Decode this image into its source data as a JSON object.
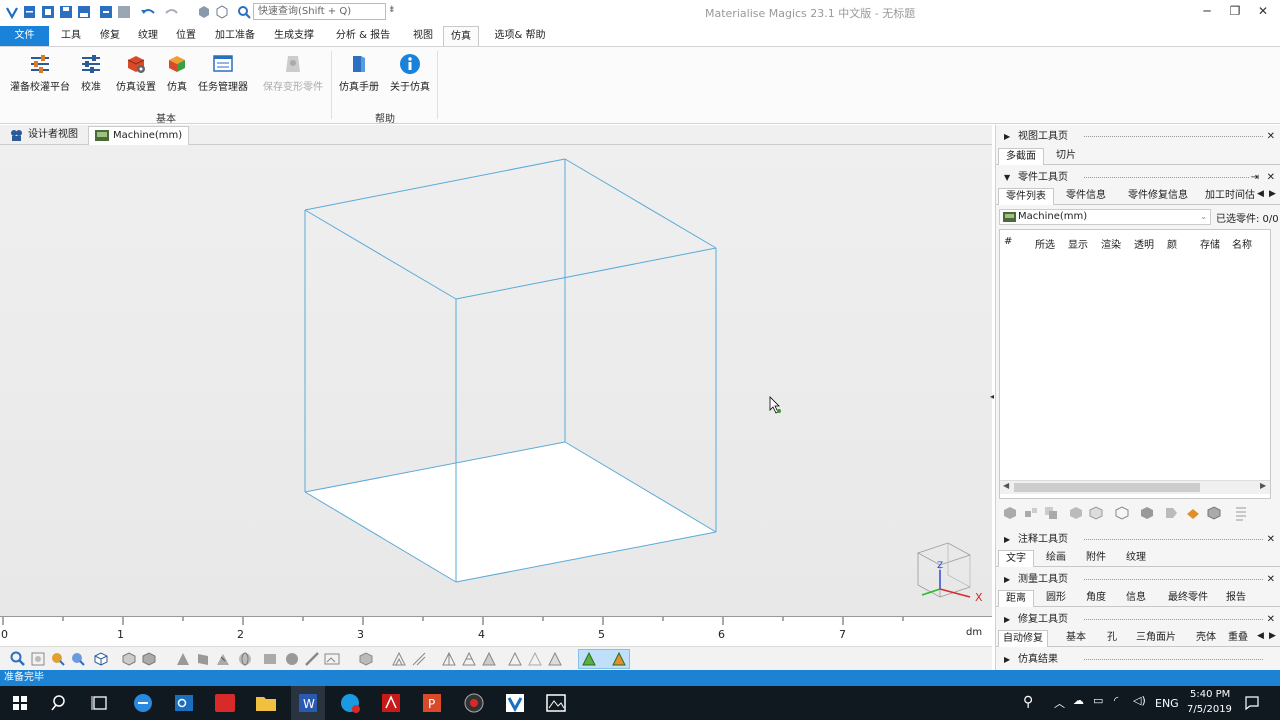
{
  "app": {
    "title": "Materialise Magics 23.1 中文版 - 无标题",
    "quick_search_placeholder": "快速查询(Shift + Q)"
  },
  "ribbon": {
    "tabs": [
      "文件",
      "工具",
      "修复",
      "纹理",
      "位置",
      "加工准备",
      "生成支撑",
      "分析 & 报告",
      "视图",
      "仿真",
      "选项& 帮助"
    ],
    "active_tab": "仿真",
    "groups": [
      {
        "label": "基本",
        "buttons": [
          "灌备校灌平台",
          "校准",
          "仿真设置",
          "仿真",
          "任务管理器",
          "保存变形零件"
        ]
      },
      {
        "label": "帮助",
        "buttons": [
          "仿真手册",
          "关于仿真"
        ]
      }
    ]
  },
  "doc_tabs": [
    "设计者视图",
    "Machine(mm)"
  ],
  "ruler": {
    "labels": [
      "0",
      "1",
      "2",
      "3",
      "4",
      "5",
      "6",
      "7"
    ],
    "unit": "dm"
  },
  "right_panel": {
    "view_toolbar": {
      "title": "视图工具页",
      "tabs": [
        "多截面",
        "切片"
      ]
    },
    "part_toolbar": {
      "title": "零件工具页",
      "tabs": [
        "零件列表",
        "零件信息",
        "零件修复信息",
        "加工时间估"
      ],
      "machine": "Machine(mm)",
      "selected_count": "已选零件: 0/0",
      "columns": [
        "#",
        "所选",
        "显示",
        "渲染",
        "透明",
        "颜",
        "存储",
        "名称"
      ]
    },
    "annotation_toolbar": {
      "title": "注释工具页",
      "tabs": [
        "文字",
        "绘画",
        "附件",
        "纹理"
      ]
    },
    "measure_toolbar": {
      "title": "测量工具页",
      "tabs": [
        "距离",
        "圆形",
        "角度",
        "信息",
        "最终零件",
        "报告"
      ]
    },
    "fix_toolbar": {
      "title": "修复工具页",
      "tabs": [
        "自动修复",
        "基本",
        "孔",
        "三角面片",
        "壳体",
        "重叠"
      ]
    },
    "sim_results": {
      "title": "仿真结果"
    }
  },
  "status": {
    "text": "准备完毕"
  },
  "taskbar": {
    "lang": "ENG",
    "time": "5:40 PM",
    "date": "7/5/2019"
  },
  "colors": {
    "accent": "#1a82d9",
    "status_bar": "#1b82d4",
    "cube_edge": "#5aaad8"
  }
}
